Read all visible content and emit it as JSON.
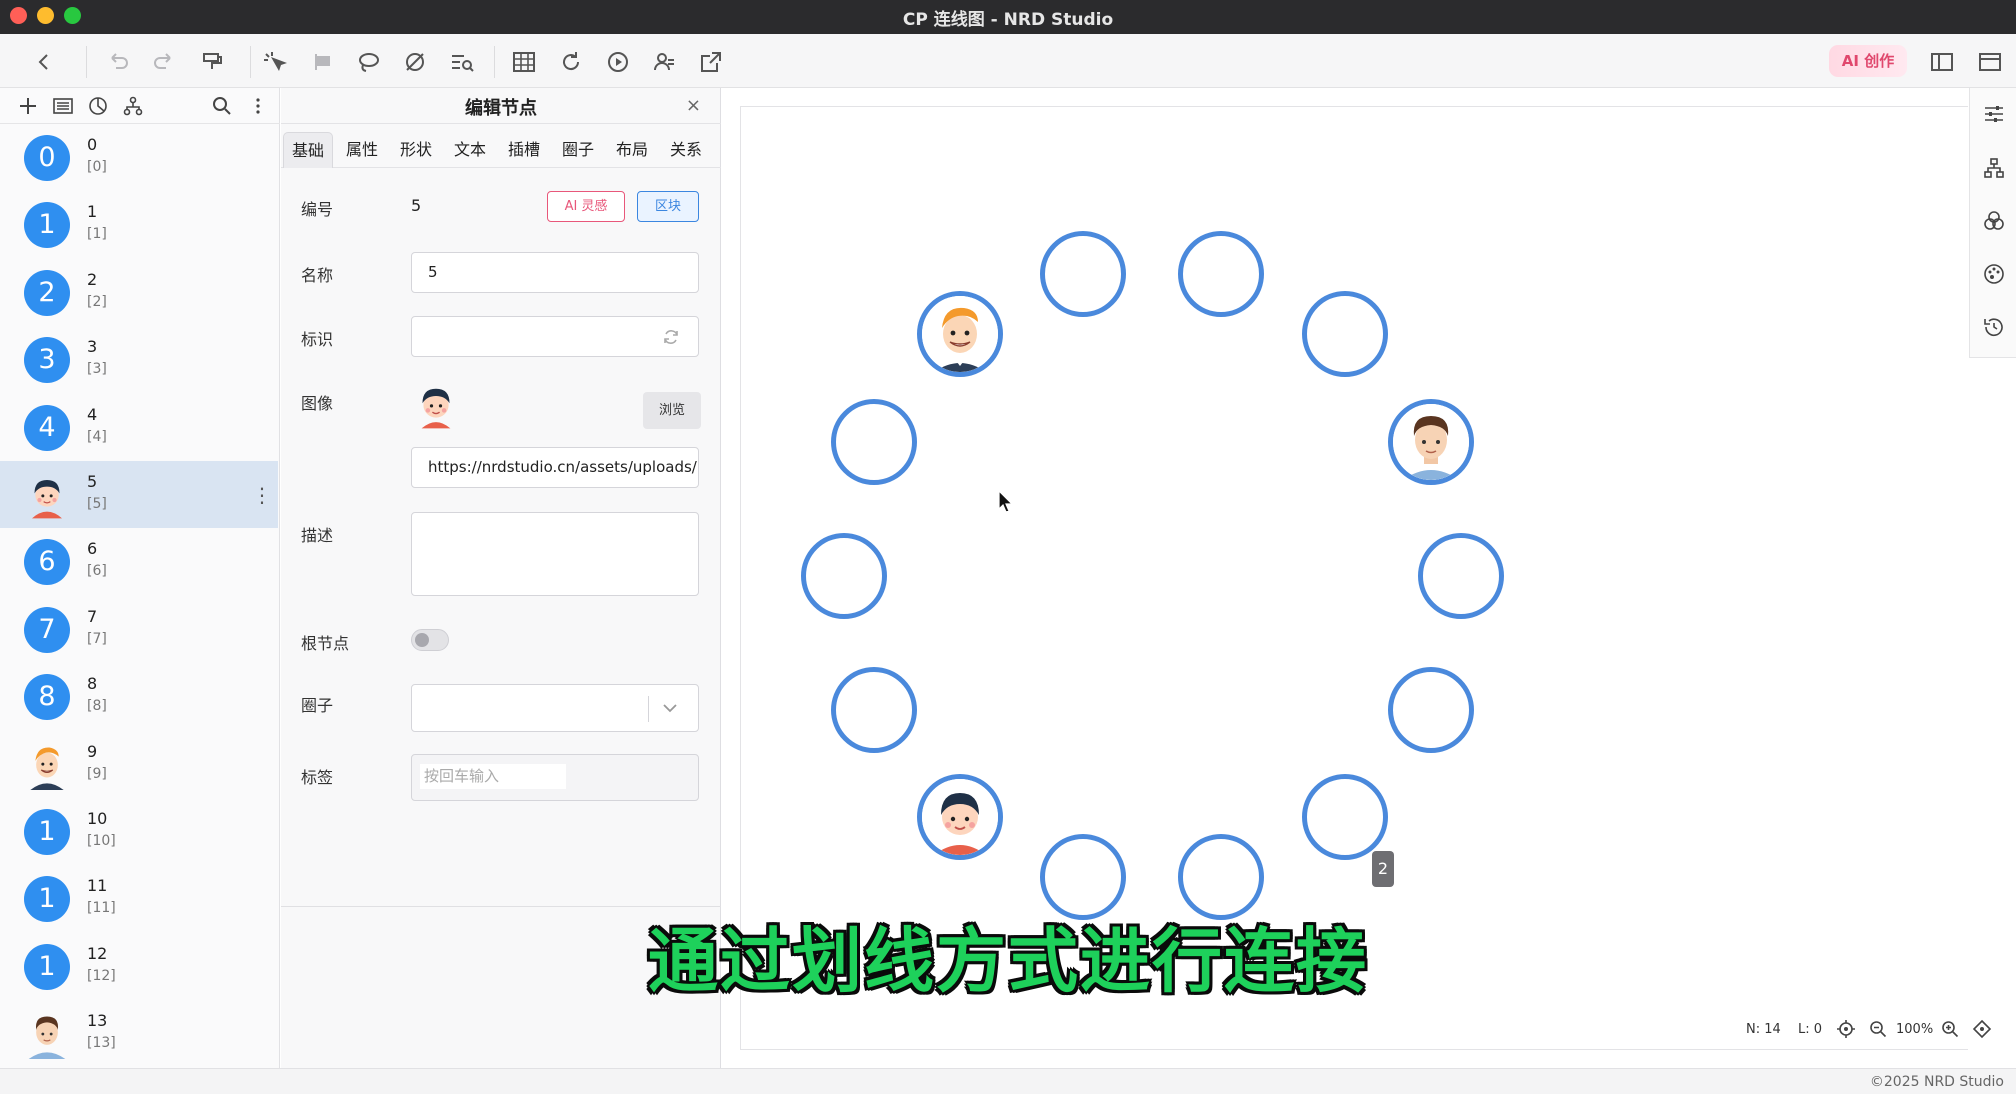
{
  "window": {
    "title": "CP 连线图 - NRD Studio"
  },
  "toolbar": {
    "ai_label": "AI 创作"
  },
  "node_list": [
    {
      "name": "0",
      "id": "[0]",
      "badge": "0",
      "avatar": ""
    },
    {
      "name": "1",
      "id": "[1]",
      "badge": "1",
      "avatar": ""
    },
    {
      "name": "2",
      "id": "[2]",
      "badge": "2",
      "avatar": ""
    },
    {
      "name": "3",
      "id": "[3]",
      "badge": "3",
      "avatar": ""
    },
    {
      "name": "4",
      "id": "[4]",
      "badge": "4",
      "avatar": ""
    },
    {
      "name": "5",
      "id": "[5]",
      "badge": "",
      "avatar": "boy-dark-hair-icon",
      "selected": true
    },
    {
      "name": "6",
      "id": "[6]",
      "badge": "6",
      "avatar": ""
    },
    {
      "name": "7",
      "id": "[7]",
      "badge": "7",
      "avatar": ""
    },
    {
      "name": "8",
      "id": "[8]",
      "badge": "8",
      "avatar": ""
    },
    {
      "name": "9",
      "id": "[9]",
      "badge": "",
      "avatar": "man-orange-hair-icon"
    },
    {
      "name": "10",
      "id": "[10]",
      "badge": "1",
      "avatar": ""
    },
    {
      "name": "11",
      "id": "[11]",
      "badge": "1",
      "avatar": ""
    },
    {
      "name": "12",
      "id": "[12]",
      "badge": "1",
      "avatar": ""
    },
    {
      "name": "13",
      "id": "[13]",
      "badge": "",
      "avatar": "man-brown-hair-icon"
    }
  ],
  "edit_panel": {
    "title": "编辑节点",
    "close": "×",
    "tabs": [
      "基础",
      "属性",
      "形状",
      "文本",
      "插槽",
      "圈子",
      "布局",
      "关系"
    ],
    "active_tab": "基础",
    "fields": {
      "number_label": "编号",
      "number_value": "5",
      "ai_inspiration": "AI 灵感",
      "block": "区块",
      "name_label": "名称",
      "name_value": "5",
      "ident_label": "标识",
      "ident_value": "",
      "image_label": "图像",
      "browse": "浏览",
      "image_url": "https://nrdstudio.cn/assets/uploads/",
      "desc_label": "描述",
      "desc_value": "",
      "root_label": "根节点",
      "circle_label": "圈子",
      "circle_value": "",
      "tags_label": "标签",
      "tags_placeholder": "按回车输入"
    }
  },
  "canvas": {
    "badge": "2",
    "subtitle": "通过划线方式进行连接"
  },
  "status": {
    "nodes": "N: 14",
    "links": "L: 0",
    "zoom": "100%"
  },
  "footer": {
    "copyright": "©2025 NRD Studio"
  },
  "colors": {
    "accent": "#2f8ff0",
    "ring": "#4a89dc",
    "subtitle": "#1ed15b"
  }
}
